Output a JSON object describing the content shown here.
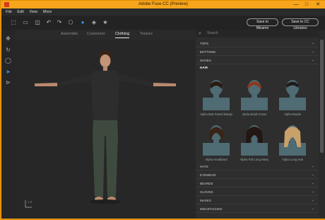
{
  "window": {
    "title": "Adobe Fuse CC (Preview)",
    "controls": [
      "—",
      "□",
      "✕"
    ]
  },
  "menu": [
    "File",
    "Edit",
    "View",
    "More"
  ],
  "toolbar": {
    "icons": [
      "cursor-icon",
      "image-icon",
      "camera-icon",
      "undo-icon",
      "redo-icon",
      "cube-icon",
      "shield-icon",
      "cc-icon",
      "star-icon"
    ],
    "save_mixamo": "Save to Mixamo",
    "save_cc": "Save to CC Libraries"
  },
  "left_tools": [
    "move-icon",
    "rotate-icon",
    "orbit-icon",
    "pointer-icon",
    "light-icon"
  ],
  "tabs": [
    {
      "label": "Assemble",
      "active": false
    },
    {
      "label": "Customize",
      "active": false
    },
    {
      "label": "Clothing",
      "active": true
    },
    {
      "label": "Texture",
      "active": false
    }
  ],
  "axes_label": "Y Z",
  "search": {
    "placeholder": "Search"
  },
  "categories_top": [
    "TOPS",
    "BOTTOMS",
    "SHOES"
  ],
  "hair_heading": "HAIR",
  "hair_items": [
    "Alpha Bob Parted Bangs",
    "Alpha Braid Crown",
    "Alpha Braids",
    "Alpha Headband",
    "Alpha Full Long Wavy",
    "Alpha Long Hair"
  ],
  "categories_bottom": [
    "HATS",
    "EYEWEAR",
    "BEARDS",
    "GLOVES",
    "MASKS",
    "MOUSTACHES"
  ],
  "colors": {
    "accent": "#f3a21b",
    "panel": "#2e2e2e",
    "thumb_bg": "#4f6b74"
  }
}
